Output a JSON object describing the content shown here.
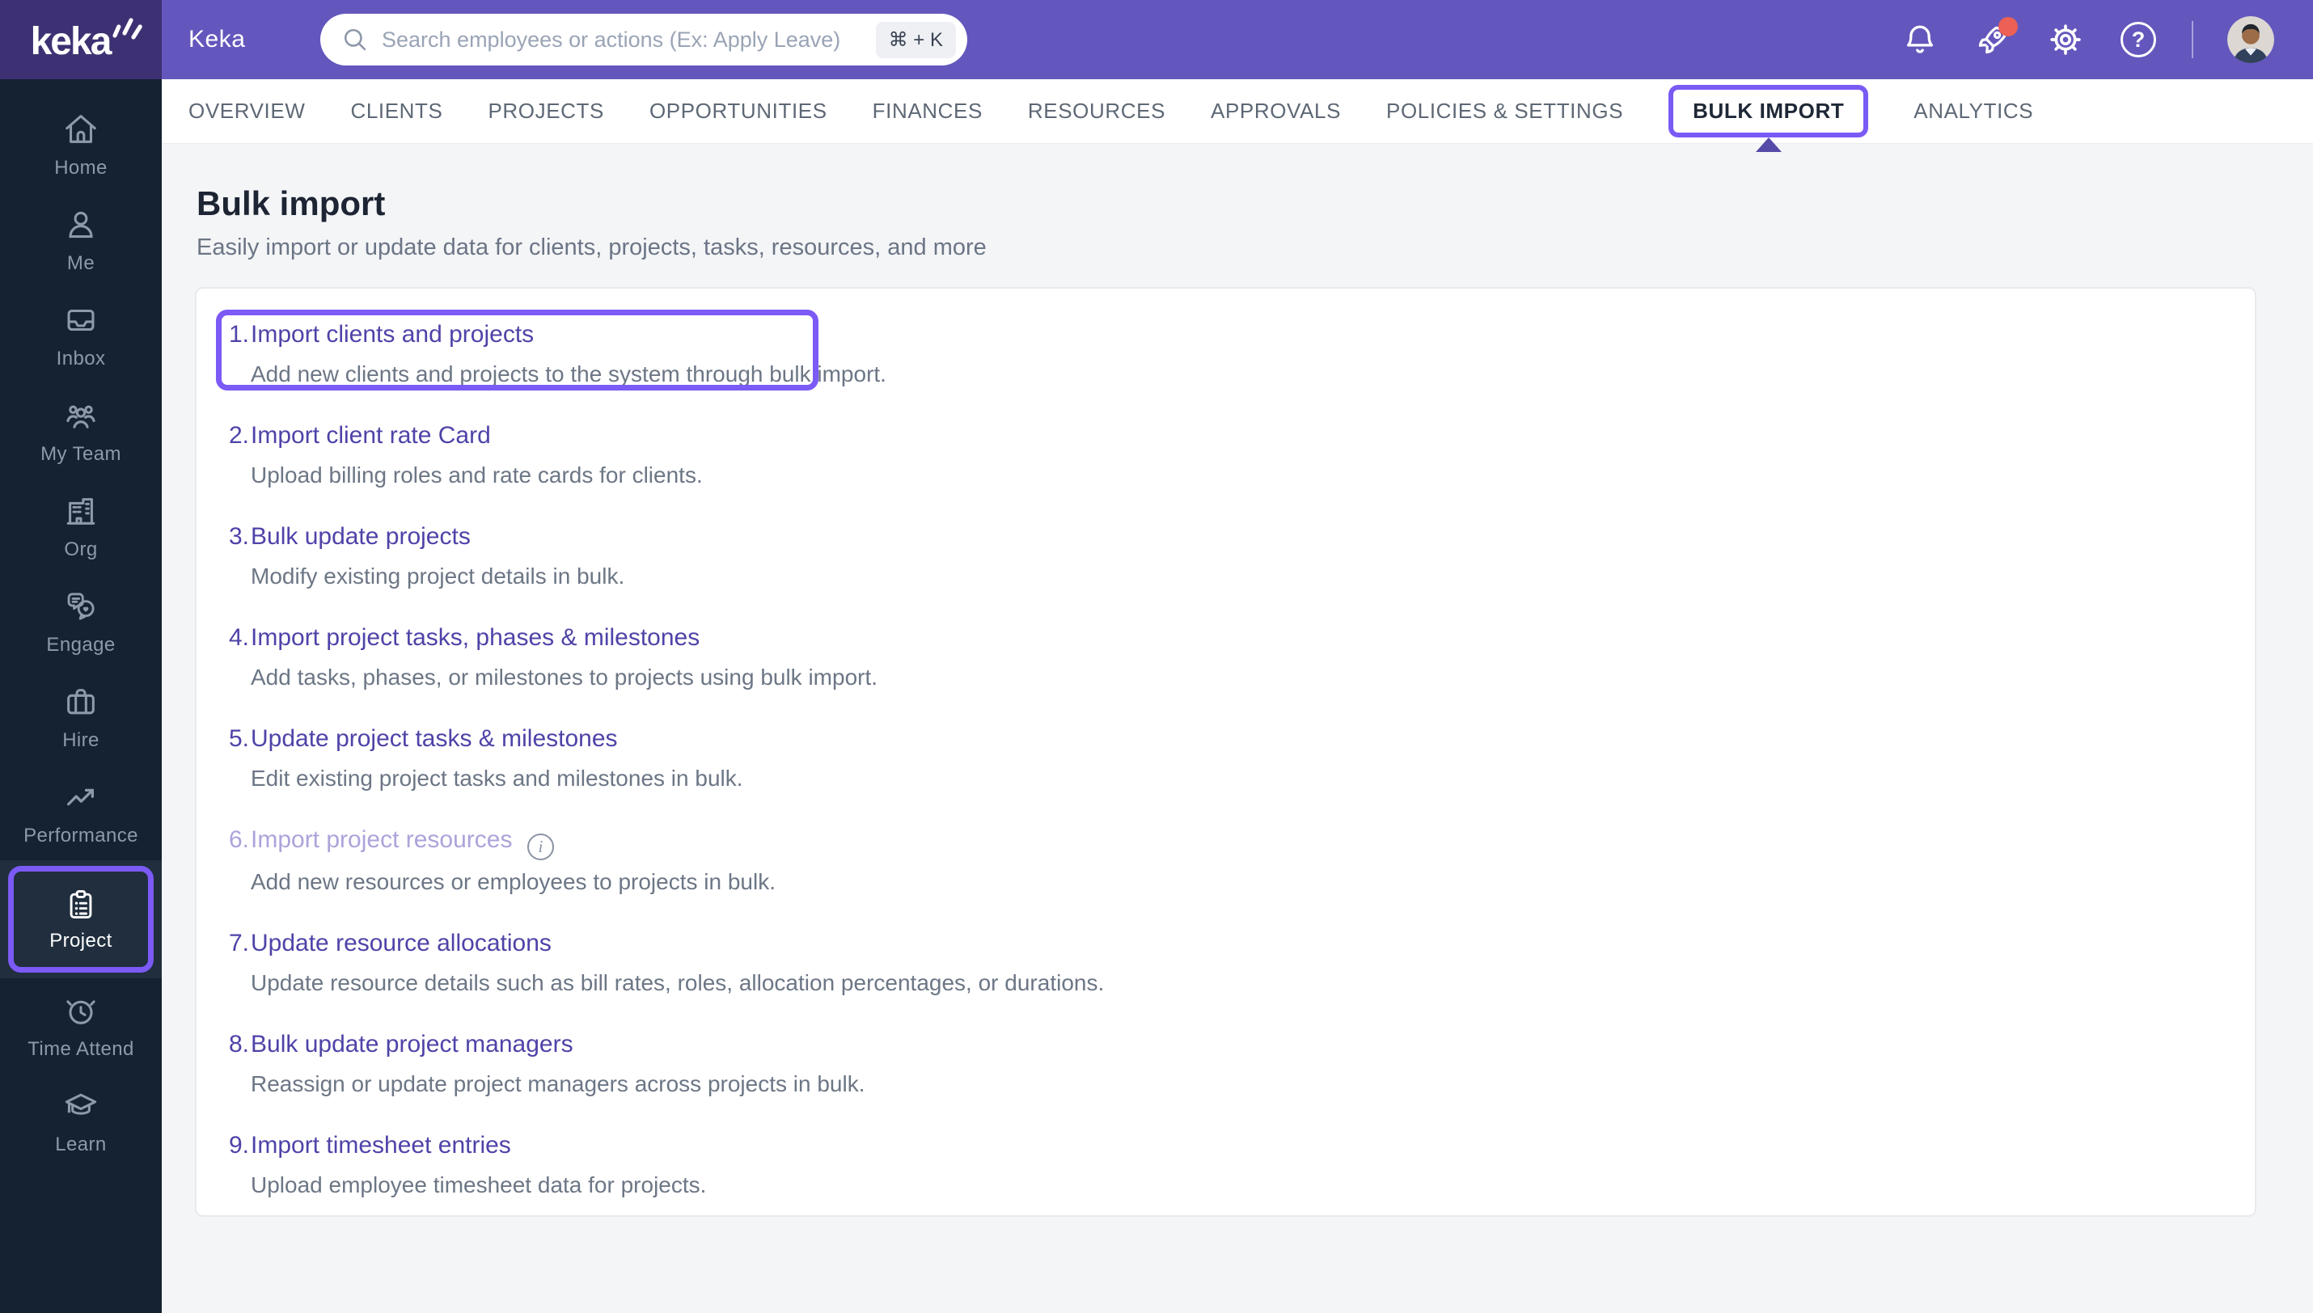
{
  "topbar": {
    "logo_text": "keka",
    "brand": "Keka",
    "search": {
      "placeholder": "Search employees or actions (Ex: Apply Leave)",
      "shortcut": "⌘ + K"
    },
    "help_glyph": "?"
  },
  "sidebar": {
    "items": [
      {
        "label": "Home"
      },
      {
        "label": "Me"
      },
      {
        "label": "Inbox"
      },
      {
        "label": "My Team"
      },
      {
        "label": "Org"
      },
      {
        "label": "Engage"
      },
      {
        "label": "Hire"
      },
      {
        "label": "Performance"
      },
      {
        "label": "Project",
        "active": true
      },
      {
        "label": "Time Attend"
      },
      {
        "label": "Learn"
      }
    ]
  },
  "tabs": {
    "items": [
      "OVERVIEW",
      "CLIENTS",
      "PROJECTS",
      "OPPORTUNITIES",
      "FINANCES",
      "RESOURCES",
      "APPROVALS",
      "POLICIES & SETTINGS",
      "BULK IMPORT",
      "ANALYTICS"
    ],
    "active": "BULK IMPORT"
  },
  "page": {
    "title": "Bulk import",
    "subtitle": "Easily import or update data for clients, projects, tasks, resources, and more"
  },
  "bulk_list": {
    "info_glyph": "i",
    "items": [
      {
        "num": "1.",
        "title": "Import clients and projects",
        "desc": "Add new clients and projects to the system through bulk import.",
        "annotated": true
      },
      {
        "num": "2.",
        "title": "Import client rate Card",
        "desc": "Upload billing roles and rate cards for clients."
      },
      {
        "num": "3.",
        "title": "Bulk update projects",
        "desc": "Modify existing project details in bulk."
      },
      {
        "num": "4.",
        "title": "Import project tasks, phases & milestones",
        "desc": "Add tasks, phases, or milestones to projects using bulk import."
      },
      {
        "num": "5.",
        "title": "Update project tasks & milestones",
        "desc": "Edit existing project tasks and milestones in bulk."
      },
      {
        "num": "6.",
        "title": "Import project resources",
        "desc": "Add new resources or employees to projects in bulk.",
        "disabled": true
      },
      {
        "num": "7.",
        "title": "Update resource allocations",
        "desc": "Update resource details such as bill rates, roles, allocation percentages, or durations."
      },
      {
        "num": "8.",
        "title": "Bulk update project managers",
        "desc": "Reassign or update project managers across projects in bulk."
      },
      {
        "num": "9.",
        "title": "Import timesheet entries",
        "desc": "Upload employee timesheet data for projects."
      }
    ]
  },
  "colors": {
    "topbar": "#6357bd",
    "logo_square": "#3e3173",
    "sidebar": "#152232",
    "annotation": "#7b5af6",
    "link": "#4e43a8",
    "disabled_link": "#aba4da",
    "notification_dot": "#ec6055"
  }
}
